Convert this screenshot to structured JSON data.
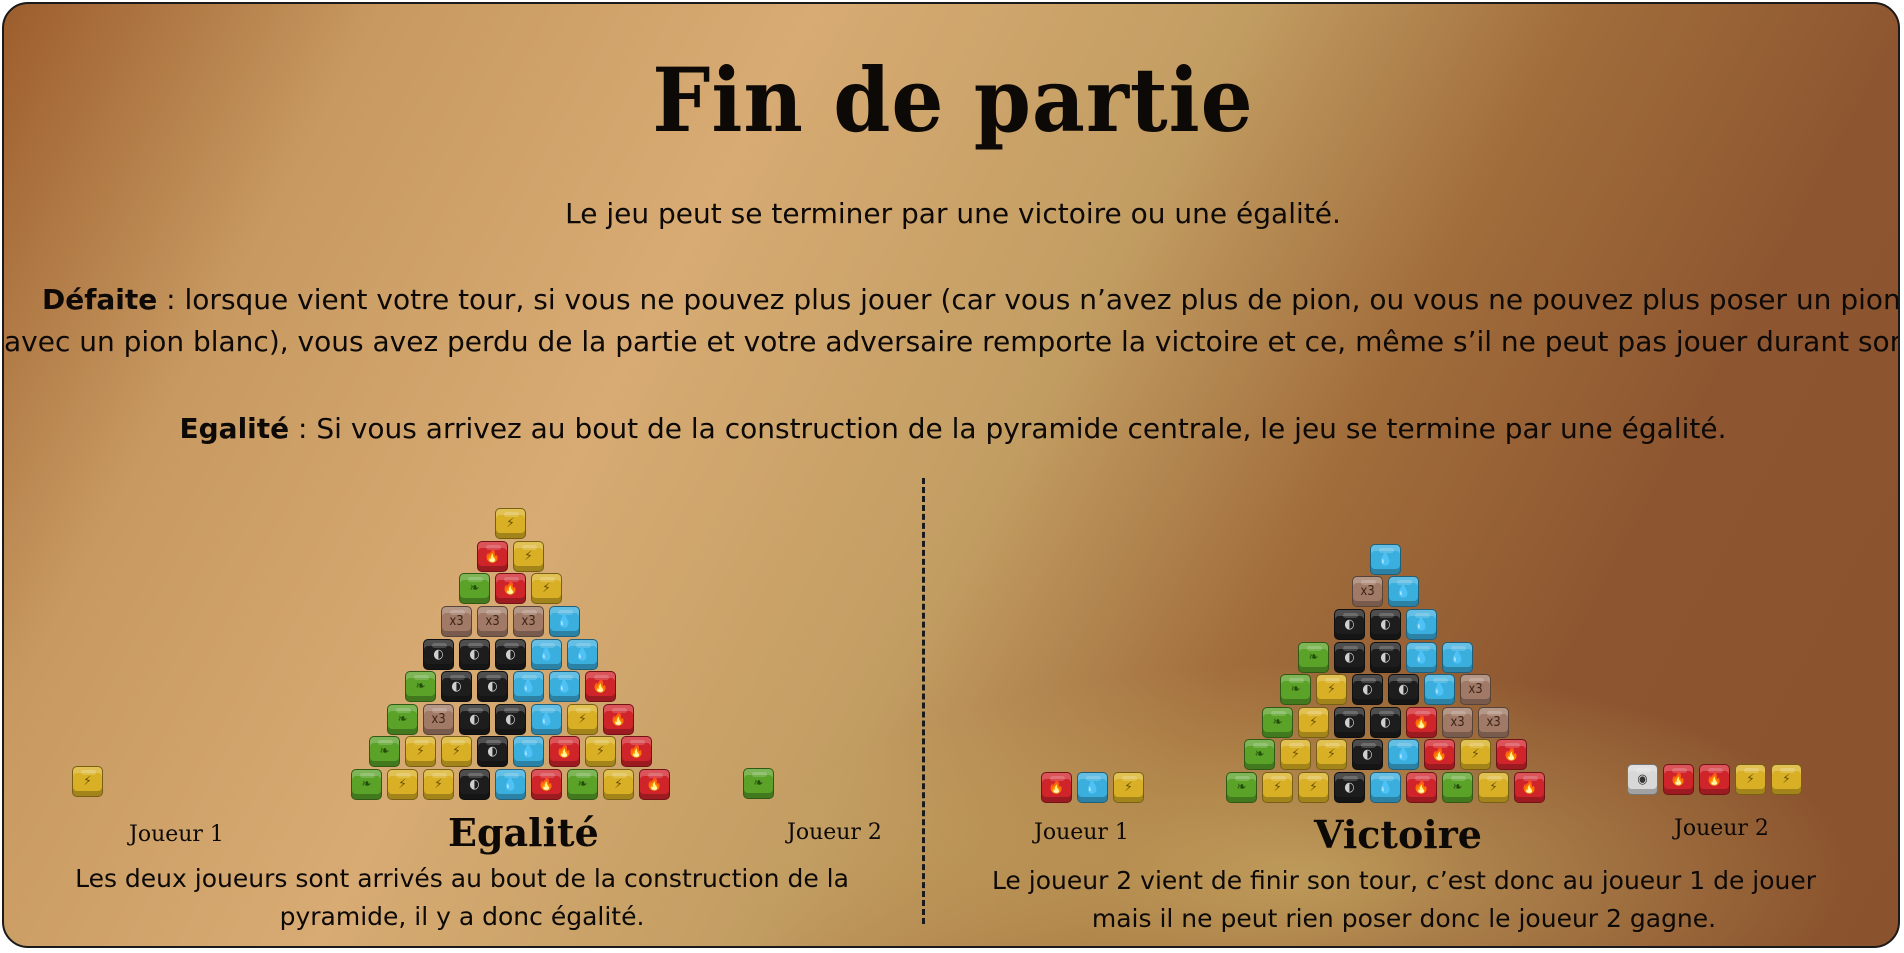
{
  "title": "Fin de partie",
  "intro": "Le jeu peut se terminer par une victoire ou une égalité.",
  "defaite": {
    "keyword": "Défaite",
    "line1": " : lorsque vient votre tour, si vous ne pouvez plus jouer (car vous n’avez plus de pion, ou vous ne pouvez plus poser un pion, ni passer votre tour",
    "line2": "avec un pion blanc), vous avez perdu de la partie et votre adversaire remporte la victoire et ce, même s’il ne peut pas jouer durant son tour."
  },
  "egalite_rule": {
    "keyword": "Egalité",
    "text": " : Si vous arrivez au bout de la construction de la pyramide centrale, le jeu se termine par une égalité."
  },
  "example_left": {
    "player1": "Joueur 1",
    "player2": "Joueur 2",
    "result": "Egalité",
    "caption": "Les deux joueurs sont arrivés au bout de la construction de la pyramide, il y a donc égalité.",
    "player1_pieces": [
      "yellow"
    ],
    "player2_pieces": [
      "green"
    ],
    "pyramid_rows": [
      [
        "green",
        "yellow",
        "yellow",
        "black",
        "blue",
        "red",
        "green",
        "yellow",
        "red"
      ],
      [
        "green",
        "yellow",
        "yellow",
        "black",
        "blue",
        "red",
        "yellow",
        "red"
      ],
      [
        "green",
        "brown",
        "black",
        "black",
        "blue",
        "yellow",
        "red"
      ],
      [
        "green",
        "black",
        "black",
        "blue",
        "blue",
        "red"
      ],
      [
        "black",
        "black",
        "black",
        "blue",
        "blue"
      ],
      [
        "brown",
        "brown",
        "brown",
        "blue"
      ],
      [
        "green",
        "red",
        "yellow"
      ],
      [
        "red",
        "yellow"
      ],
      [
        "yellow"
      ]
    ]
  },
  "example_right": {
    "player1": "Joueur 1",
    "player2": "Joueur 2",
    "result": "Victoire",
    "caption": "Le joueur 2 vient de finir son tour, c’est donc au joueur 1 de jouer mais il ne peut rien poser donc le joueur 2 gagne.",
    "player1_pieces": [
      "red",
      "blue",
      "yellow"
    ],
    "player2_pieces": [
      "white",
      "red",
      "red",
      "yellow",
      "yellow"
    ],
    "pyramid_rows": [
      [
        "green",
        "yellow",
        "yellow",
        "black",
        "blue",
        "red",
        "green",
        "yellow",
        "red"
      ],
      [
        "green",
        "yellow",
        "yellow",
        "black",
        "blue",
        "red",
        "yellow",
        "red"
      ],
      [
        "green",
        "yellow",
        "black",
        "black",
        "red",
        "brown",
        "brown"
      ],
      [
        "green",
        "yellow",
        "black",
        "black",
        "blue",
        "brown"
      ],
      [
        "green",
        "black",
        "black",
        "blue",
        "blue"
      ],
      [
        "black",
        "black",
        "blue"
      ],
      [
        "brown",
        "blue"
      ],
      [
        "blue"
      ]
    ]
  },
  "piece_icons": {
    "yellow": "lightning-icon",
    "red": "flame-icon",
    "green": "leaf-icon",
    "blue": "water-drop-icon",
    "black": "moon-icon",
    "brown": "x3-icon",
    "white": "dot-icon"
  },
  "piece_glyphs": {
    "yellow": "⚡",
    "red": "🔥",
    "green": "❧",
    "blue": "💧",
    "black": "◐",
    "brown": "x3",
    "white": "◉"
  },
  "colors": {
    "yellow": "#d9b025",
    "red": "#d0242b",
    "green": "#5aa228",
    "blue": "#3aaedd",
    "black": "#1d1d1d",
    "brown": "#a07a66",
    "white": "#d8d8d8"
  }
}
